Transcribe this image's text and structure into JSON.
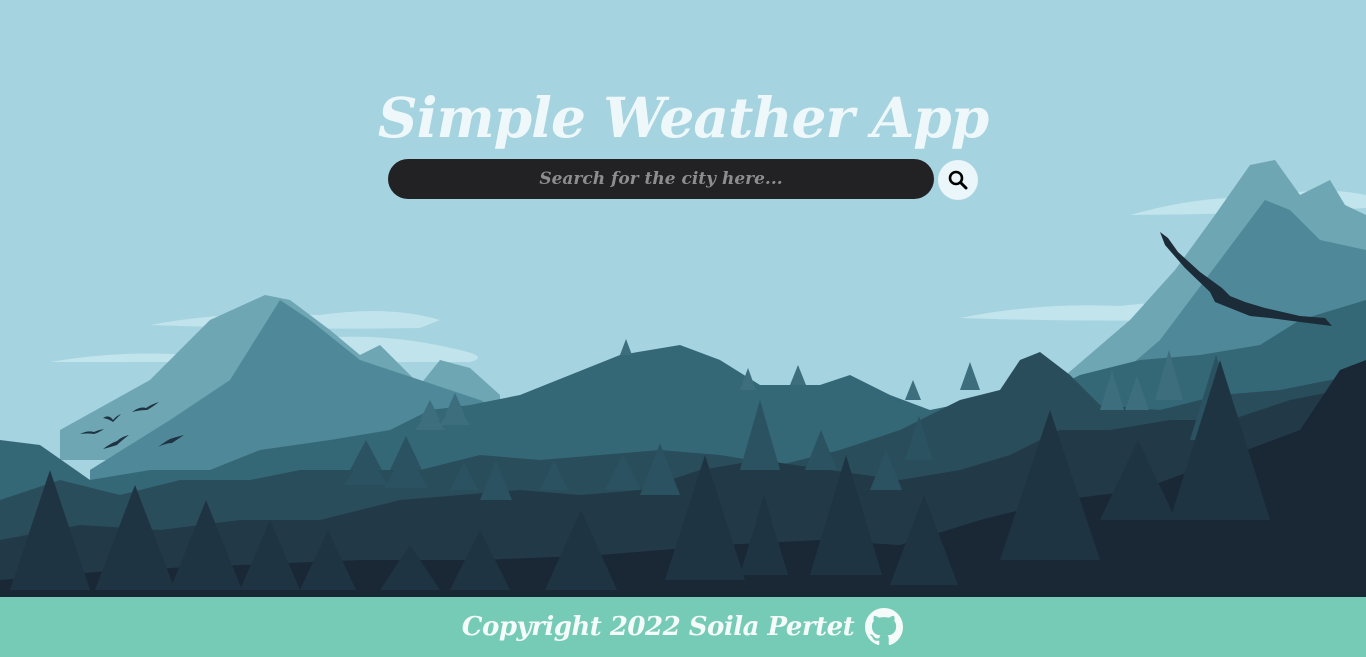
{
  "page": {
    "title": "Simple Weather App"
  },
  "search": {
    "placeholder": "Search for the city here...",
    "value": "",
    "button_icon": "search-icon"
  },
  "footer": {
    "copyright": "Copyright 2022 Soila Pertet",
    "link_icon": "github-icon"
  },
  "colors": {
    "sky": "#a5d3df",
    "search_bg": "#222225",
    "footer_bg": "#76cbb6",
    "title": "#eef8fb"
  }
}
